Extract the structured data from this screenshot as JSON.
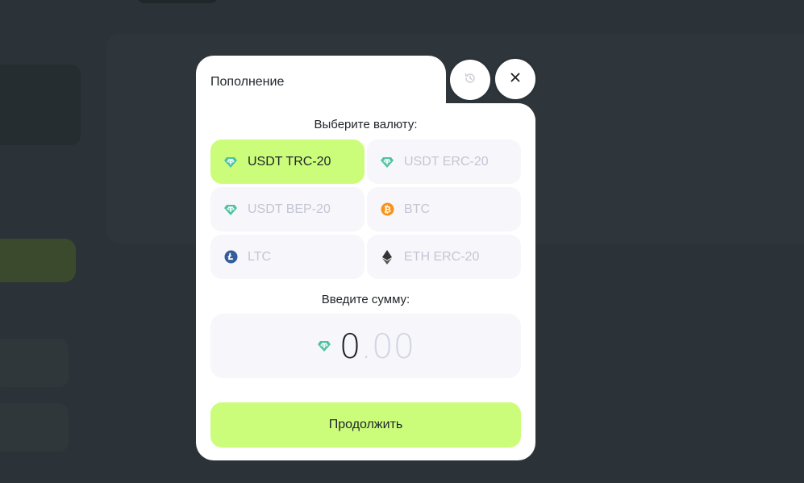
{
  "modal": {
    "title": "Пополнение",
    "history_icon": "history-icon",
    "close_icon": "close-icon",
    "currency_prompt": "Выберите валюту:",
    "amount_prompt": "Введите сумму:",
    "continue_label": "Продолжить"
  },
  "currencies": [
    {
      "label": "USDT TRC-20",
      "icon": "tether-icon",
      "selected": true
    },
    {
      "label": "USDT ERC-20",
      "icon": "tether-icon",
      "selected": false
    },
    {
      "label": "USDT BEP-20",
      "icon": "tether-icon",
      "selected": false
    },
    {
      "label": "BTC",
      "icon": "bitcoin-icon",
      "selected": false
    },
    {
      "label": "LTC",
      "icon": "litecoin-icon",
      "selected": false
    },
    {
      "label": "ETH ERC-20",
      "icon": "ethereum-icon",
      "selected": false
    }
  ],
  "amount": {
    "integer": "0",
    "decimal": ".00",
    "icon": "tether-icon"
  },
  "colors": {
    "accent": "#cbfd7b",
    "tether": "#4fc3a1",
    "bitcoin": "#f7931a",
    "litecoin": "#345d9d",
    "ethereum": "#343434",
    "backdrop": "#2b3338"
  }
}
